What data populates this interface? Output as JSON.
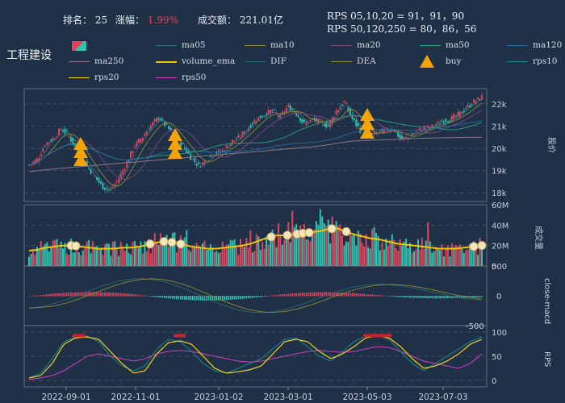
{
  "header": {
    "rank_label": "排名：",
    "rank_value": "25",
    "change_label": "涨幅：",
    "change_value": "1.99%",
    "turnover_label": "成交额：",
    "turnover_value": "221.01亿",
    "rps_line1": "RPS 05,10,20 = 91，91，90",
    "rps_line2": "RPS 50,120,250 = 80，86，56"
  },
  "stock_name": "工程建设",
  "colors": {
    "background": "#1f3047",
    "up": "#e0455c",
    "down": "#2ec4b0",
    "volume_ema": "#f5c400",
    "buy": "#f5a300",
    "change_text": "#e0455c",
    "grid": "#4a5a70"
  },
  "legend": [
    {
      "label": "",
      "color": "#e0455c",
      "kind": "candle"
    },
    {
      "label": "ma05",
      "color": "#3a6e7c"
    },
    {
      "label": "ma10",
      "color": "#8a8a3c"
    },
    {
      "label": "ma20",
      "color": "#7a4a7e"
    },
    {
      "label": "ma50",
      "color": "#2ea080"
    },
    {
      "label": "ma120",
      "color": "#2a6aa0"
    },
    {
      "label": "ma250",
      "color": "#8a7a8a"
    },
    {
      "label": "volume_ema",
      "color": "#f5c400"
    },
    {
      "label": "DIF",
      "color": "#2a6a6a"
    },
    {
      "label": "DEA",
      "color": "#8a8a3c"
    },
    {
      "label": "buy",
      "color": "#f5a300",
      "kind": "marker"
    },
    {
      "label": "rps10",
      "color": "#1a8a8a"
    },
    {
      "label": "rps20",
      "color": "#f0d020"
    },
    {
      "label": "rps50",
      "color": "#d040c0"
    }
  ],
  "chart_data": {
    "type": "line",
    "x_ticks": [
      "2022-09-01",
      "2022-11-01",
      "2023-01-02",
      "2023-03-01",
      "2023-05-03",
      "2023-07-03"
    ],
    "price_panel": {
      "ylabel": "股价",
      "y_ticks": [
        "18k",
        "19k",
        "20k",
        "21k",
        "22k"
      ],
      "ylim": [
        17900,
        22400
      ],
      "close_series": [
        19250,
        19500,
        20200,
        20450,
        20900,
        20500,
        19900,
        19300,
        18800,
        18300,
        18100,
        18600,
        19300,
        20100,
        20500,
        21000,
        21400,
        21000,
        20500,
        20100,
        19600,
        19200,
        19500,
        19800,
        19900,
        20300,
        20500,
        20900,
        21300,
        21500,
        21700,
        21400,
        21900,
        21600,
        21100,
        21300,
        21200,
        21000,
        21700,
        22100,
        21300,
        20800,
        20600,
        20700,
        20800,
        20900,
        20400,
        20500,
        20800,
        20900,
        21000,
        21200,
        21300,
        21500,
        21800,
        22100,
        22300
      ],
      "ma250": [
        18950,
        19020,
        19080,
        19130,
        19180,
        19230,
        19280,
        19330,
        19380,
        19430,
        19480,
        19530,
        19580,
        19630,
        19680,
        19730,
        19780,
        19830,
        19880,
        19930,
        19980,
        20030,
        20080,
        20150,
        20250,
        20330,
        20360,
        20380,
        20400,
        20420,
        20450,
        20470,
        20480,
        20490,
        20500,
        20500
      ]
    },
    "volume_panel": {
      "ylabel": "成交量",
      "y_ticks": [
        "0",
        "20M",
        "40M",
        "60M"
      ],
      "ylim": [
        0,
        60
      ],
      "volume_ema": [
        15,
        16,
        18,
        19,
        20,
        20,
        19,
        18,
        17,
        17,
        17,
        18,
        18,
        19,
        21,
        23,
        24,
        23,
        21,
        19,
        18,
        17,
        17,
        18,
        19,
        20,
        22,
        25,
        28,
        30,
        30,
        31,
        32,
        33,
        34,
        36,
        37,
        34,
        31,
        29,
        27,
        26,
        24,
        22,
        21,
        20,
        19,
        18,
        17,
        17,
        17,
        18,
        19,
        20
      ]
    },
    "macd_panel": {
      "ylabel": "close-macd",
      "y_ticks": [
        "500",
        "0",
        "-500"
      ],
      "ylim": [
        -500,
        500
      ]
    },
    "rps_panel": {
      "ylabel": "RPS",
      "y_ticks": [
        "0",
        "50",
        "100"
      ],
      "ylim": [
        0,
        100
      ],
      "rps20": [
        5,
        10,
        35,
        75,
        88,
        90,
        85,
        60,
        35,
        15,
        20,
        55,
        78,
        82,
        75,
        50,
        25,
        15,
        18,
        22,
        30,
        55,
        80,
        85,
        80,
        60,
        45,
        55,
        70,
        88,
        92,
        88,
        70,
        45,
        25,
        30,
        40,
        55,
        75,
        85
      ],
      "rps10": [
        5,
        15,
        45,
        80,
        90,
        92,
        80,
        50,
        30,
        20,
        30,
        65,
        85,
        80,
        60,
        35,
        20,
        15,
        25,
        35,
        45,
        65,
        85,
        88,
        70,
        50,
        40,
        60,
        80,
        92,
        95,
        85,
        60,
        35,
        20,
        35,
        50,
        65,
        80,
        90
      ],
      "rps50": [
        2,
        5,
        10,
        20,
        35,
        50,
        55,
        50,
        45,
        40,
        45,
        55,
        60,
        62,
        60,
        55,
        50,
        45,
        40,
        38,
        40,
        45,
        50,
        55,
        60,
        62,
        60,
        58,
        60,
        65,
        70,
        68,
        60,
        50,
        40,
        35,
        30,
        25,
        35,
        55
      ]
    }
  }
}
